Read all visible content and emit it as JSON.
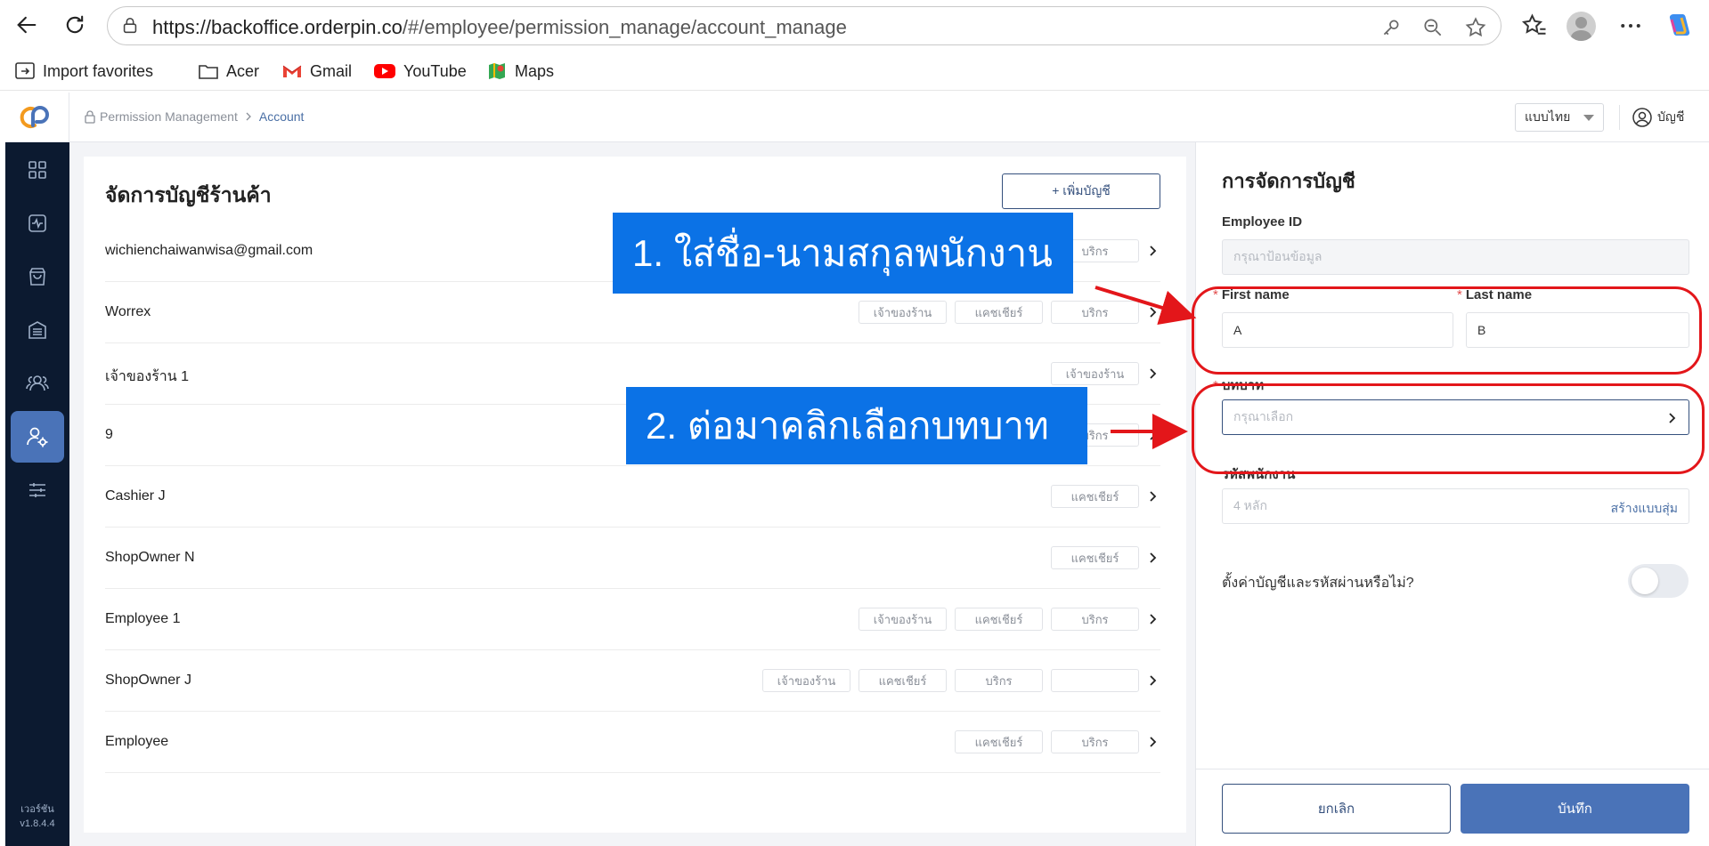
{
  "browser": {
    "url_host": "https://backoffice.orderpin.co",
    "url_path": "/#/employee/permission_manage/account_manage",
    "bookmarks": [
      "Import favorites",
      "Acer",
      "Gmail",
      "YouTube",
      "Maps"
    ]
  },
  "header": {
    "breadcrumb_root": "Permission Management",
    "breadcrumb_current": "Account",
    "language": "แบบไทย",
    "account_label": "บัญชี"
  },
  "sidebar": {
    "version_label": "เวอร์ชัน",
    "version": "v1.8.4.4"
  },
  "main": {
    "title": "จัดการบัญชีร้านค้า",
    "add_button": "+ เพิ่มบัญชี",
    "accounts": [
      {
        "name": "wichienchaiwanwisa@gmail.com",
        "tags": [
          "บริกร"
        ]
      },
      {
        "name": "Worrex",
        "tags": [
          "เจ้าของร้าน",
          "แคชเชียร์",
          "บริกร"
        ]
      },
      {
        "name": "เจ้าของร้าน 1",
        "tags": [
          "เจ้าของร้าน"
        ]
      },
      {
        "name": "9",
        "tags": [
          "บริกร"
        ]
      },
      {
        "name": "Cashier J",
        "tags": [
          "แคชเชียร์"
        ]
      },
      {
        "name": "ShopOwner N",
        "tags": [
          "แคชเชียร์"
        ]
      },
      {
        "name": "Employee 1",
        "tags": [
          "เจ้าของร้าน",
          "แคชเชียร์",
          "บริกร"
        ]
      },
      {
        "name": "ShopOwner J",
        "tags": [
          "เจ้าของร้าน",
          "แคชเชียร์",
          "บริกร",
          ""
        ]
      },
      {
        "name": "Employee",
        "tags": [
          "แคชเชียร์",
          "บริกร"
        ]
      }
    ]
  },
  "panel": {
    "title": "การจัดการบัญชี",
    "employee_id_label": "Employee ID",
    "employee_id_placeholder": "กรุณาป้อนข้อมูล",
    "first_name_label": "First name",
    "first_name_value": "A",
    "last_name_label": "Last name",
    "last_name_value": "B",
    "role_label": "บทบาท",
    "role_placeholder": "กรุณาเลือก",
    "code_label": "รหัสพนักงาน",
    "code_placeholder": "4 หลัก",
    "code_generate": "สร้างแบบสุ่ม",
    "setup_question": "ตั้งค่าบัญชีและรหัสผ่านหรือไม่?",
    "setup_enabled": false,
    "required_mark": "*",
    "cancel": "ยกเลิก",
    "save": "บันทึก"
  },
  "annotations": {
    "step1": "1. ใส่ชื่อ-นามสกุลพนักงาน",
    "step2": "2. ต่อมาคลิกเลือกบทบาท",
    "callout_color": "#0b72e6",
    "highlight_color": "#e3161a"
  },
  "colors": {
    "sidebar_bg": "#0c1a30",
    "accent": "#4a73b8",
    "brand_orange": "#f39a1e"
  }
}
